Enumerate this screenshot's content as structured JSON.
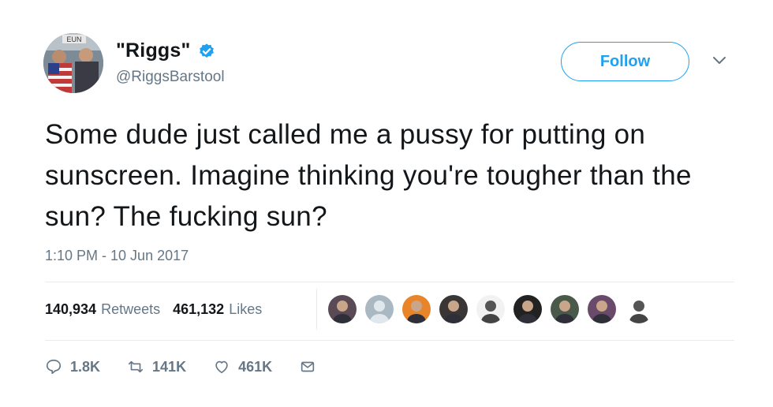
{
  "author": {
    "display_name": "\"Riggs\"",
    "handle": "@RiggsBarstool",
    "verified": true,
    "avatar_text": "EUN"
  },
  "follow_label": "Follow",
  "tweet_text": "Some dude just called me a pussy for putting on sunscreen. Imagine thinking you're tougher than the sun? The fucking sun?",
  "timestamp": "1:10 PM - 10 Jun 2017",
  "stats": {
    "retweets_count": "140,934",
    "retweets_label": "Retweets",
    "likes_count": "461,132",
    "likes_label": "Likes"
  },
  "liked_by_avatars": [
    {
      "name": "liker-avatar-1",
      "color": "#5a4a55"
    },
    {
      "name": "liker-avatar-2",
      "color": "#aab8c2"
    },
    {
      "name": "liker-avatar-3",
      "color": "#e8852a"
    },
    {
      "name": "liker-avatar-4",
      "color": "#3a3636"
    },
    {
      "name": "liker-avatar-5",
      "color": "#f2f2f2"
    },
    {
      "name": "liker-avatar-6",
      "color": "#222222"
    },
    {
      "name": "liker-avatar-7",
      "color": "#4a5a4a"
    },
    {
      "name": "liker-avatar-8",
      "color": "#6a4a6a"
    },
    {
      "name": "liker-avatar-9",
      "color": "#ffffff"
    }
  ],
  "actions": {
    "replies": "1.8K",
    "retweets": "141K",
    "likes": "461K"
  },
  "colors": {
    "accent": "#1da1f2",
    "secondary_text": "#657786",
    "divider": "#e6ecf0"
  }
}
